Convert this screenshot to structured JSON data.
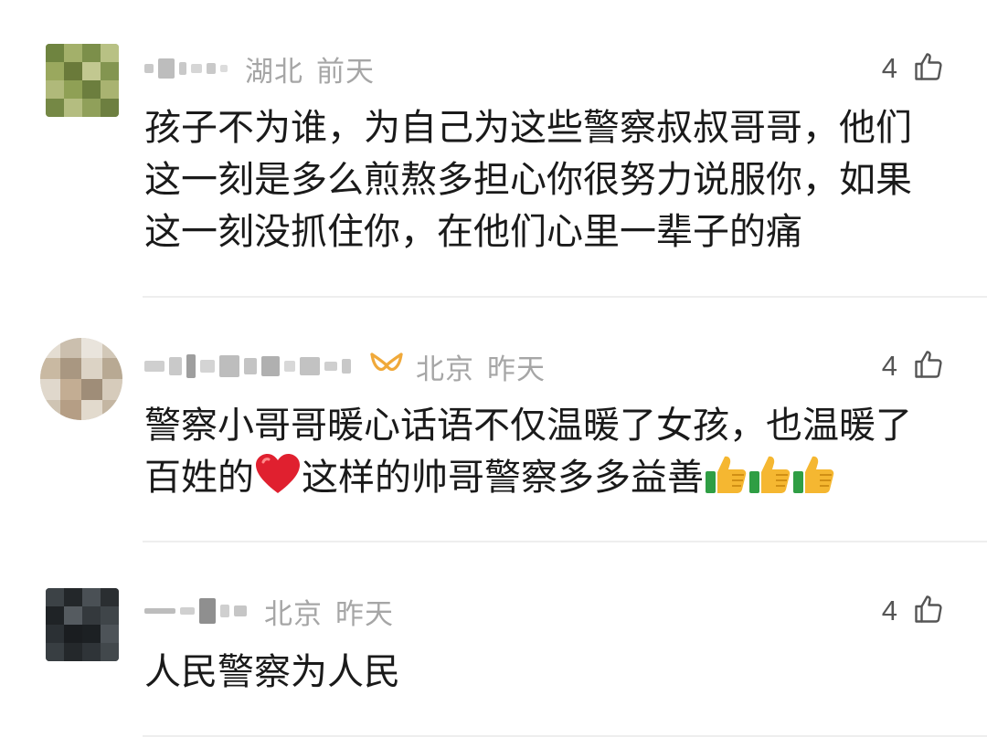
{
  "comments": [
    {
      "location": "湖北",
      "time": "前天",
      "likes": "4",
      "text": "孩子不为谁，为自己为这些警察叔叔哥哥，他们这一刻是多么煎熬多担心你很努力说服你，如果这一刻没抓住你，在他们心里一辈子的痛",
      "has_vip_badge": false
    },
    {
      "location": "北京",
      "time": "昨天",
      "likes": "4",
      "text_before_heart": "警察小哥哥暖心话语不仅温暖了女孩，也温暖了百姓的",
      "text_after_heart": "这样的帅哥警察多多益善",
      "emojis": [
        "heart",
        "thumbs-up",
        "thumbs-up",
        "thumbs-up"
      ],
      "has_vip_badge": true
    },
    {
      "location": "北京",
      "time": "昨天",
      "likes": "4",
      "text": "人民警察为人民",
      "has_vip_badge": false
    }
  ],
  "colors": {
    "meta": "#a6a6a6",
    "text": "#1a1a1a",
    "divider": "#eeeeee",
    "vip_badge": "#f0a93a"
  }
}
